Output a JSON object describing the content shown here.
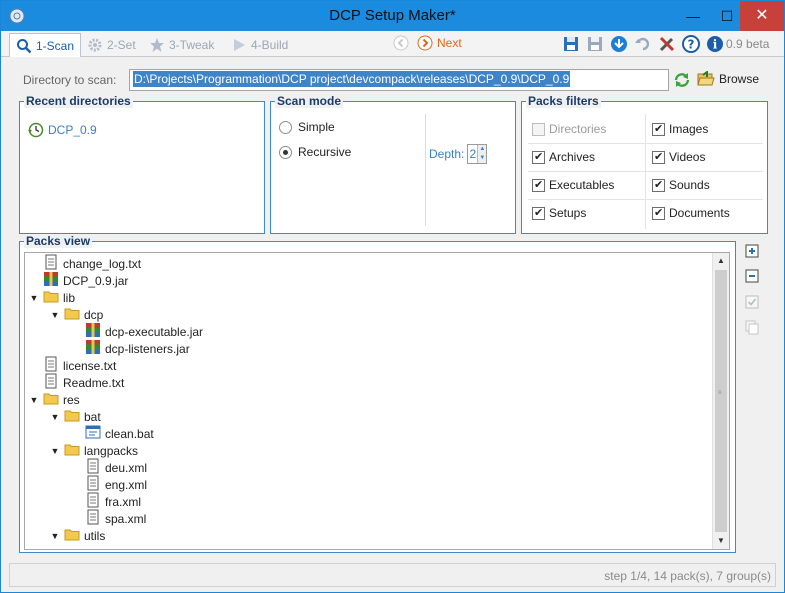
{
  "window": {
    "title": "DCP Setup Maker*",
    "min_glyph": "—",
    "max_glyph": "☐",
    "close_glyph": "✕"
  },
  "toolbar": {
    "tabs": [
      {
        "label": "1-Scan",
        "icon": "magnifier-icon",
        "active": true
      },
      {
        "label": "2-Set",
        "icon": "gear-icon",
        "active": false
      },
      {
        "label": "3-Tweak",
        "icon": "star-icon",
        "active": false
      },
      {
        "label": "4-Build",
        "icon": "play-icon",
        "active": false
      }
    ],
    "next_label": "Next",
    "version": "0.9 beta"
  },
  "directory": {
    "label": "Directory to scan:",
    "value": "D:\\Projects\\Programmation\\DCP project\\devcompack\\releases\\DCP_0.9\\DCP_0.9",
    "browse_label": "Browse"
  },
  "recent": {
    "legend": "Recent directories",
    "items": [
      "DCP_0.9"
    ]
  },
  "scan_mode": {
    "legend": "Scan mode",
    "simple_label": "Simple",
    "recursive_label": "Recursive",
    "selected": "Recursive",
    "depth_label": "Depth:",
    "depth_value": "2"
  },
  "filters": {
    "legend": "Packs filters",
    "items": [
      {
        "label": "Directories",
        "checked": false,
        "disabled": true
      },
      {
        "label": "Images",
        "checked": true,
        "disabled": false
      },
      {
        "label": "Archives",
        "checked": true,
        "disabled": false
      },
      {
        "label": "Videos",
        "checked": true,
        "disabled": false
      },
      {
        "label": "Executables",
        "checked": true,
        "disabled": false
      },
      {
        "label": "Sounds",
        "checked": true,
        "disabled": false
      },
      {
        "label": "Setups",
        "checked": true,
        "disabled": false
      },
      {
        "label": "Documents",
        "checked": true,
        "disabled": false
      }
    ]
  },
  "packs_view": {
    "legend": "Packs view",
    "rows": [
      {
        "name": "change_log.txt",
        "kind": "text",
        "depth": 0,
        "expanded": null
      },
      {
        "name": "DCP_0.9.jar",
        "kind": "archive",
        "depth": 0,
        "expanded": null
      },
      {
        "name": "lib",
        "kind": "folder",
        "depth": 0,
        "expanded": true
      },
      {
        "name": "dcp",
        "kind": "folder",
        "depth": 1,
        "expanded": true
      },
      {
        "name": "dcp-executable.jar",
        "kind": "archive",
        "depth": 2,
        "expanded": null
      },
      {
        "name": "dcp-listeners.jar",
        "kind": "archive",
        "depth": 2,
        "expanded": null
      },
      {
        "name": "license.txt",
        "kind": "text",
        "depth": 0,
        "expanded": null
      },
      {
        "name": "Readme.txt",
        "kind": "text",
        "depth": 0,
        "expanded": null
      },
      {
        "name": "res",
        "kind": "folder",
        "depth": 0,
        "expanded": true
      },
      {
        "name": "bat",
        "kind": "folder",
        "depth": 1,
        "expanded": true
      },
      {
        "name": "clean.bat",
        "kind": "script",
        "depth": 2,
        "expanded": null
      },
      {
        "name": "langpacks",
        "kind": "folder",
        "depth": 1,
        "expanded": true
      },
      {
        "name": "deu.xml",
        "kind": "text",
        "depth": 2,
        "expanded": null
      },
      {
        "name": "eng.xml",
        "kind": "text",
        "depth": 2,
        "expanded": null
      },
      {
        "name": "fra.xml",
        "kind": "text",
        "depth": 2,
        "expanded": null
      },
      {
        "name": "spa.xml",
        "kind": "text",
        "depth": 2,
        "expanded": null
      },
      {
        "name": "utils",
        "kind": "folder",
        "depth": 1,
        "expanded": true
      }
    ],
    "scroll_fraction": 0.0
  },
  "status": {
    "text": "step 1/4, 14 pack(s), 7 group(s)"
  },
  "colors": {
    "accent": "#1b8be0",
    "group_border": "#3b8ad0",
    "link_blue": "#3a7fc2",
    "next_orange": "#e0661a",
    "close_red": "#c7413a"
  }
}
